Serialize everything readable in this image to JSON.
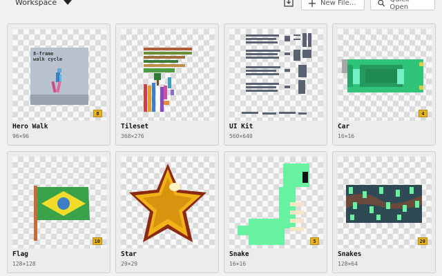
{
  "toolbar": {
    "workspace_label": "Workspace",
    "new_file_label": "New File…",
    "quick_open_label": "Quick Open"
  },
  "sprites": [
    {
      "name": "Hero Walk",
      "size": "96×96",
      "frames": "8",
      "caption": [
        "8-frame",
        "walk cycle"
      ]
    },
    {
      "name": "Tileset",
      "size": "368×276",
      "frames": ""
    },
    {
      "name": "UI Kit",
      "size": "560×640",
      "frames": ""
    },
    {
      "name": "Car",
      "size": "16×16",
      "frames": "4"
    },
    {
      "name": "Flag",
      "size": "128×128",
      "frames": "10"
    },
    {
      "name": "Star",
      "size": "29×29",
      "frames": ""
    },
    {
      "name": "Snake",
      "size": "16×16",
      "frames": "5"
    },
    {
      "name": "Snakes",
      "size": "128×64",
      "frames": "20"
    }
  ],
  "colors": {
    "badge": "#e4b31c",
    "flag_green": "#3aa34a",
    "flag_yellow": "#f2dc2a",
    "flag_blue": "#3e7fc4",
    "snake_green": "#66f2a0",
    "car_body": "#2fc47a",
    "star_gold": "#f0b419"
  }
}
